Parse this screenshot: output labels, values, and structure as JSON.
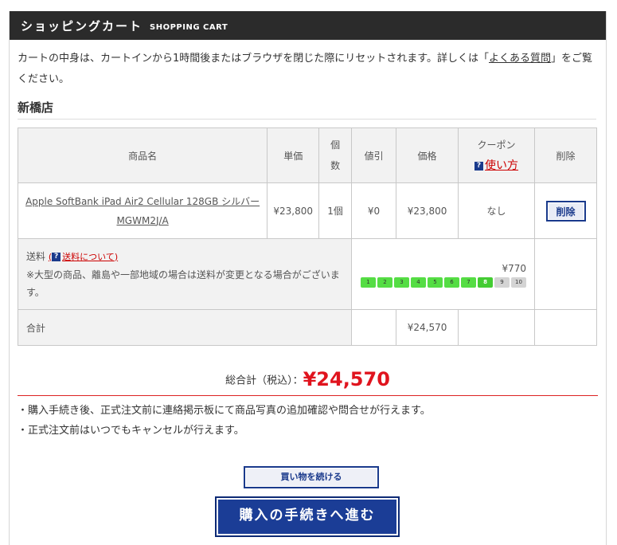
{
  "header": {
    "title_jp": "ショッピングカート",
    "title_en": "SHOPPING CART"
  },
  "notice": {
    "text_before": "カートの中身は、カートインから1時間後またはブラウザを閉じた際にリセットされます。詳しくは「",
    "faq_link": "よくある質問",
    "text_after": "」をご覧ください。"
  },
  "store_name": "新橋店",
  "table": {
    "headers": {
      "product": "商品名",
      "unit_price": "単価",
      "qty_line1": "個",
      "qty_line2": "数",
      "discount": "値引",
      "price": "価格",
      "coupon": "クーポン",
      "coupon_link": "使い方",
      "delete": "削除",
      "help_icon": "?"
    },
    "row": {
      "product_name_line1": "Apple SoftBank iPad Air2 Cellular 128GB シルバー",
      "product_name_line2": "MGWM2J/A",
      "unit_price": "¥23,800",
      "qty": "1個",
      "discount": "¥0",
      "price": "¥23,800",
      "coupon": "なし",
      "delete_button": "削除"
    },
    "shipping": {
      "label": "送料",
      "link_open": "(",
      "link": "送料について",
      "link_close": ")",
      "note": "※大型の商品、離島や一部地域の場合は送料が変更となる場合がございます。",
      "amount": "¥770",
      "scale": [
        "1",
        "2",
        "3",
        "4",
        "5",
        "6",
        "7",
        "8",
        "9",
        "10"
      ],
      "scale_level": 8
    },
    "total": {
      "label": "合計",
      "amount": "¥24,570"
    }
  },
  "grand_total": {
    "label": "総合計（税込）：",
    "amount": "¥24,570"
  },
  "bullets": [
    "・購入手続き後、正式注文前に連絡掲示板にて商品写真の追加確認や問合せが行えます。",
    "・正式注文前はいつでもキャンセルが行えます。"
  ],
  "buttons": {
    "continue": "買い物を続ける",
    "checkout": "購入の手続きへ進む"
  },
  "colors": {
    "header_bg": "#2b2b2b",
    "accent_red": "#e0141e",
    "button_blue": "#1b3d96",
    "scale_green": "#55dd44"
  }
}
